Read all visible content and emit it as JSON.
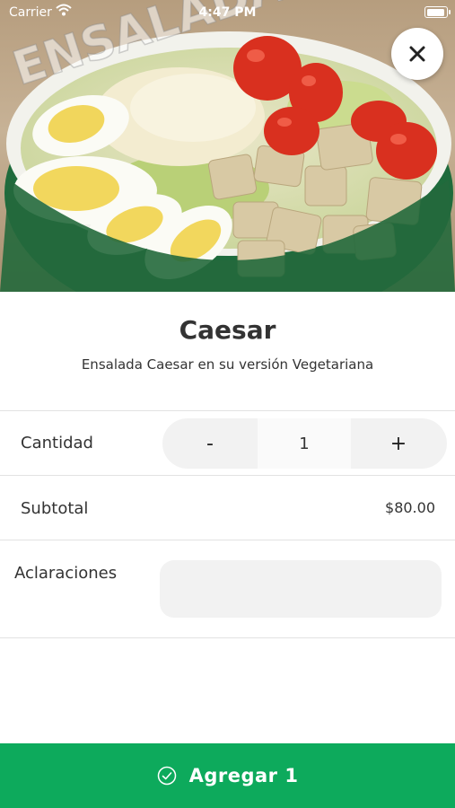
{
  "status_bar": {
    "carrier": "Carrier",
    "time": "4:47 PM",
    "battery_level": 0.92
  },
  "hero": {
    "photo_text": "ENSALADA",
    "close_icon": "close-icon"
  },
  "product": {
    "name": "Caesar",
    "description": "Ensalada Caesar en su versión Vegetariana"
  },
  "quantity": {
    "label": "Cantidad",
    "minus": "-",
    "value": "1",
    "plus": "+"
  },
  "subtotal": {
    "label": "Subtotal",
    "value": "$80.00"
  },
  "notes": {
    "label": "Aclaraciones",
    "placeholder": "",
    "value": ""
  },
  "add_button": {
    "label": "Agregar 1",
    "icon": "check-circle-icon",
    "color": "#0daa5c"
  }
}
